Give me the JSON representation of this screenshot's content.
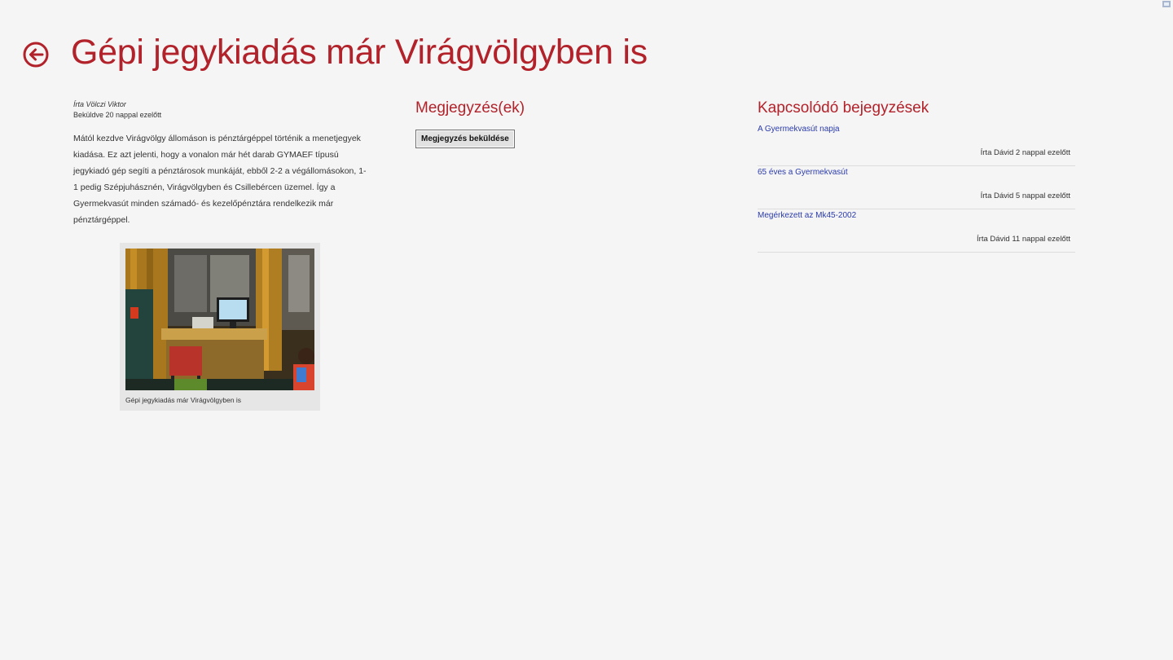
{
  "header": {
    "back_icon": "back-arrow-circle-icon",
    "title": "Gépi jegykiadás már Virágvölgyben is"
  },
  "article": {
    "author": "Írta Völczi Viktor",
    "posted": "Beküldve 20 nappal ezelőtt",
    "body": "Mától kezdve Virágvölgy állomáson is pénztárgéppel történik a menetjegyek kiadása. Ez azt jelenti, hogy a vonalon már hét darab GYMAEF típusú jegykiadó gép segíti a pénztárosok munkáját, ebből 2-2 a végállomásokon, 1-1 pedig Szépjuhásznén, Virágvölgyben és Csillebércen üzemel. Így a Gyermekvasút minden számadó- és kezelőpénztára rendelkezik már pénztárgéppel.",
    "figure_caption": "Gépi jegykiadás már Virágvölgyben is"
  },
  "comments": {
    "heading": "Megjegyzés(ek)",
    "submit_label": "Megjegyzés beküldése"
  },
  "related": {
    "heading": "Kapcsolódó bejegyzések",
    "items": [
      {
        "title": "A Gyermekvasút napja",
        "meta": "Írta Dávid 2 nappal ezelőtt"
      },
      {
        "title": "65 éves a Gyermekvasút",
        "meta": "Írta Dávid 5 nappal ezelőtt"
      },
      {
        "title": "Megérkezett az Mk45-2002",
        "meta": "Írta Dávid 11 nappal ezelőtt"
      }
    ]
  },
  "colors": {
    "accent": "#b2222a",
    "link": "#2a3bab",
    "background": "#f5f5f5"
  }
}
